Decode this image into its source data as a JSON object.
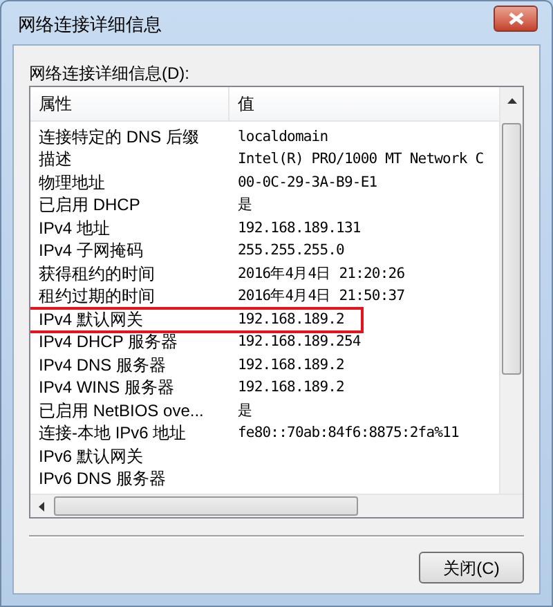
{
  "window": {
    "title": "网络连接详细信息"
  },
  "list_label": "网络连接详细信息(D):",
  "table": {
    "columns": [
      "属性",
      "值"
    ],
    "rows": [
      {
        "property": "连接特定的 DNS 后缀",
        "value": "localdomain",
        "highlighted": false
      },
      {
        "property": "描述",
        "value": "Intel(R) PRO/1000 MT Network C",
        "highlighted": false
      },
      {
        "property": "物理地址",
        "value": "00-0C-29-3A-B9-E1",
        "highlighted": false
      },
      {
        "property": "已启用 DHCP",
        "value": "是",
        "highlighted": false
      },
      {
        "property": "IPv4 地址",
        "value": "192.168.189.131",
        "highlighted": false
      },
      {
        "property": "IPv4 子网掩码",
        "value": "255.255.255.0",
        "highlighted": false
      },
      {
        "property": "获得租约的时间",
        "value": "2016年4月4日 21:20:26",
        "highlighted": false
      },
      {
        "property": "租约过期的时间",
        "value": "2016年4月4日 21:50:37",
        "highlighted": false
      },
      {
        "property": "IPv4 默认网关",
        "value": "192.168.189.2",
        "highlighted": true
      },
      {
        "property": "IPv4 DHCP 服务器",
        "value": "192.168.189.254",
        "highlighted": false
      },
      {
        "property": "IPv4 DNS 服务器",
        "value": "192.168.189.2",
        "highlighted": false
      },
      {
        "property": "IPv4 WINS 服务器",
        "value": "192.168.189.2",
        "highlighted": false
      },
      {
        "property": "已启用 NetBIOS ove...",
        "value": "是",
        "highlighted": false
      },
      {
        "property": "连接-本地 IPv6 地址",
        "value": "fe80::70ab:84f6:8875:2fa%11",
        "highlighted": false
      },
      {
        "property": "IPv6 默认网关",
        "highlighted": false
      },
      {
        "property": "IPv6 DNS 服务器",
        "highlighted": false
      }
    ]
  },
  "close_button": "关闭(C)"
}
